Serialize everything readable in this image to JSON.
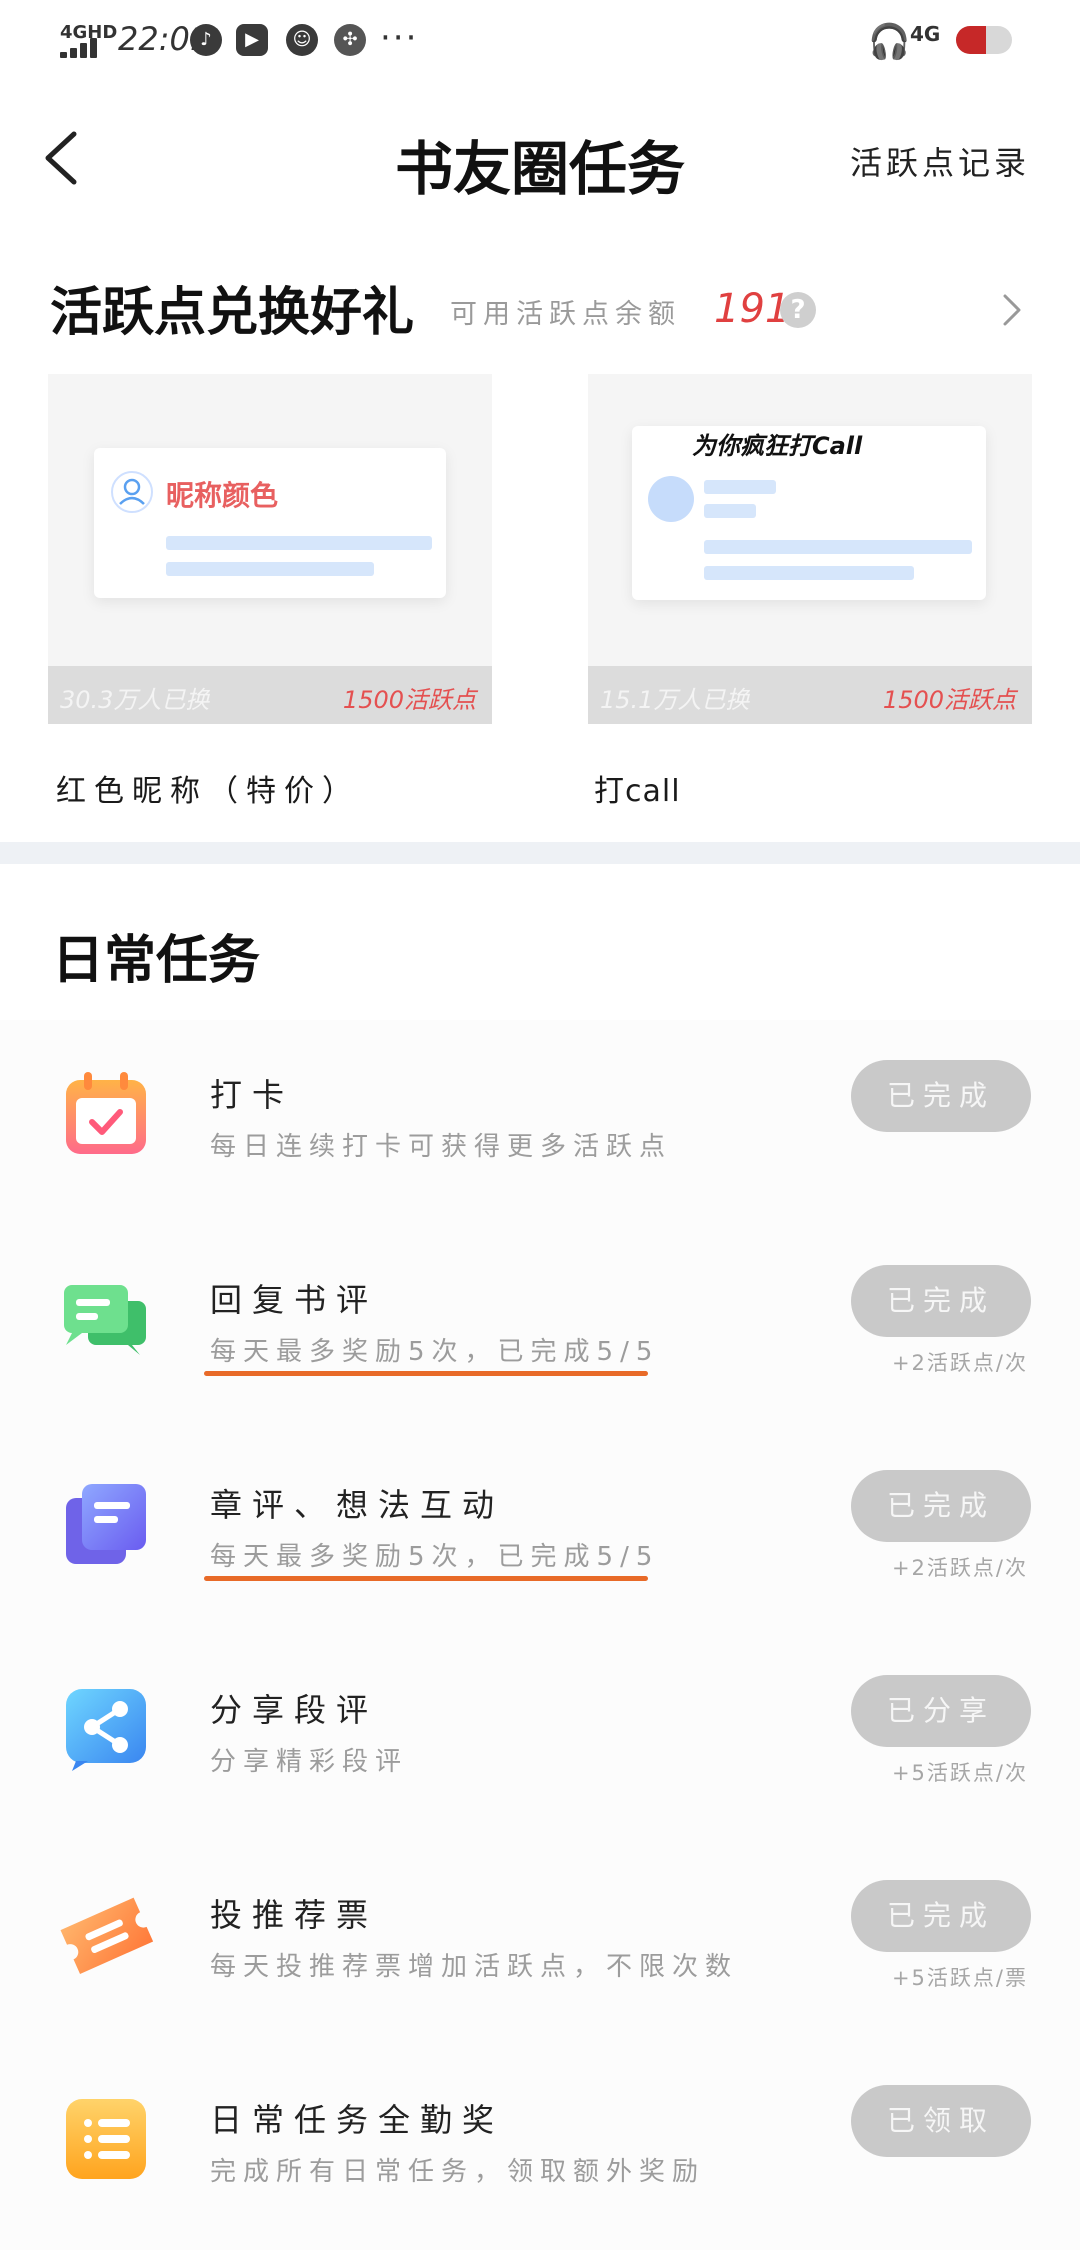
{
  "status_bar": {
    "network": "4GHD",
    "time": "22:01",
    "network_right": "4G",
    "more": "···"
  },
  "header": {
    "title": "书友圈任务",
    "record_link": "活跃点记录"
  },
  "exchange": {
    "title": "活跃点兑换好礼",
    "balance_label": "可用活跃点余额",
    "balance_value": "191",
    "help": "?",
    "gifts": [
      {
        "preview_label": "昵称颜色",
        "count": "30.3万人已换",
        "cost": "1500活跃点",
        "name": "红色昵称（特价）"
      },
      {
        "preview_label": "为你疯狂打Call",
        "count": "15.1万人已换",
        "cost": "1500活跃点",
        "name": "打call"
      }
    ]
  },
  "daily": {
    "title": "日常任务",
    "tasks": [
      {
        "icon": "calendar-check-icon",
        "title": "打卡",
        "subtitle": "每日连续打卡可获得更多活跃点",
        "button": "已完成",
        "reward": ""
      },
      {
        "icon": "chat-bubble-icon",
        "title": "回复书评",
        "subtitle": "每天最多奖励5次，已完成5/5",
        "button": "已完成",
        "reward": "+2活跃点/次"
      },
      {
        "icon": "document-icon",
        "title": "章评、想法互动",
        "subtitle": "每天最多奖励5次，已完成5/5",
        "button": "已完成",
        "reward": "+2活跃点/次"
      },
      {
        "icon": "share-icon",
        "title": "分享段评",
        "subtitle": "分享精彩段评",
        "button": "已分享",
        "reward": "+5活跃点/次"
      },
      {
        "icon": "ticket-icon",
        "title": "投推荐票",
        "subtitle": "每天投推荐票增加活跃点，不限次数",
        "button": "已完成",
        "reward": "+5活跃点/票"
      },
      {
        "icon": "list-icon",
        "title": "日常任务全勤奖",
        "subtitle": "完成所有日常任务，领取额外奖励",
        "button": "已领取",
        "reward": ""
      }
    ]
  },
  "colors": {
    "accent_red": "#e04040",
    "underline_orange": "#e86a28",
    "button_gray": "#c9c9c9"
  }
}
